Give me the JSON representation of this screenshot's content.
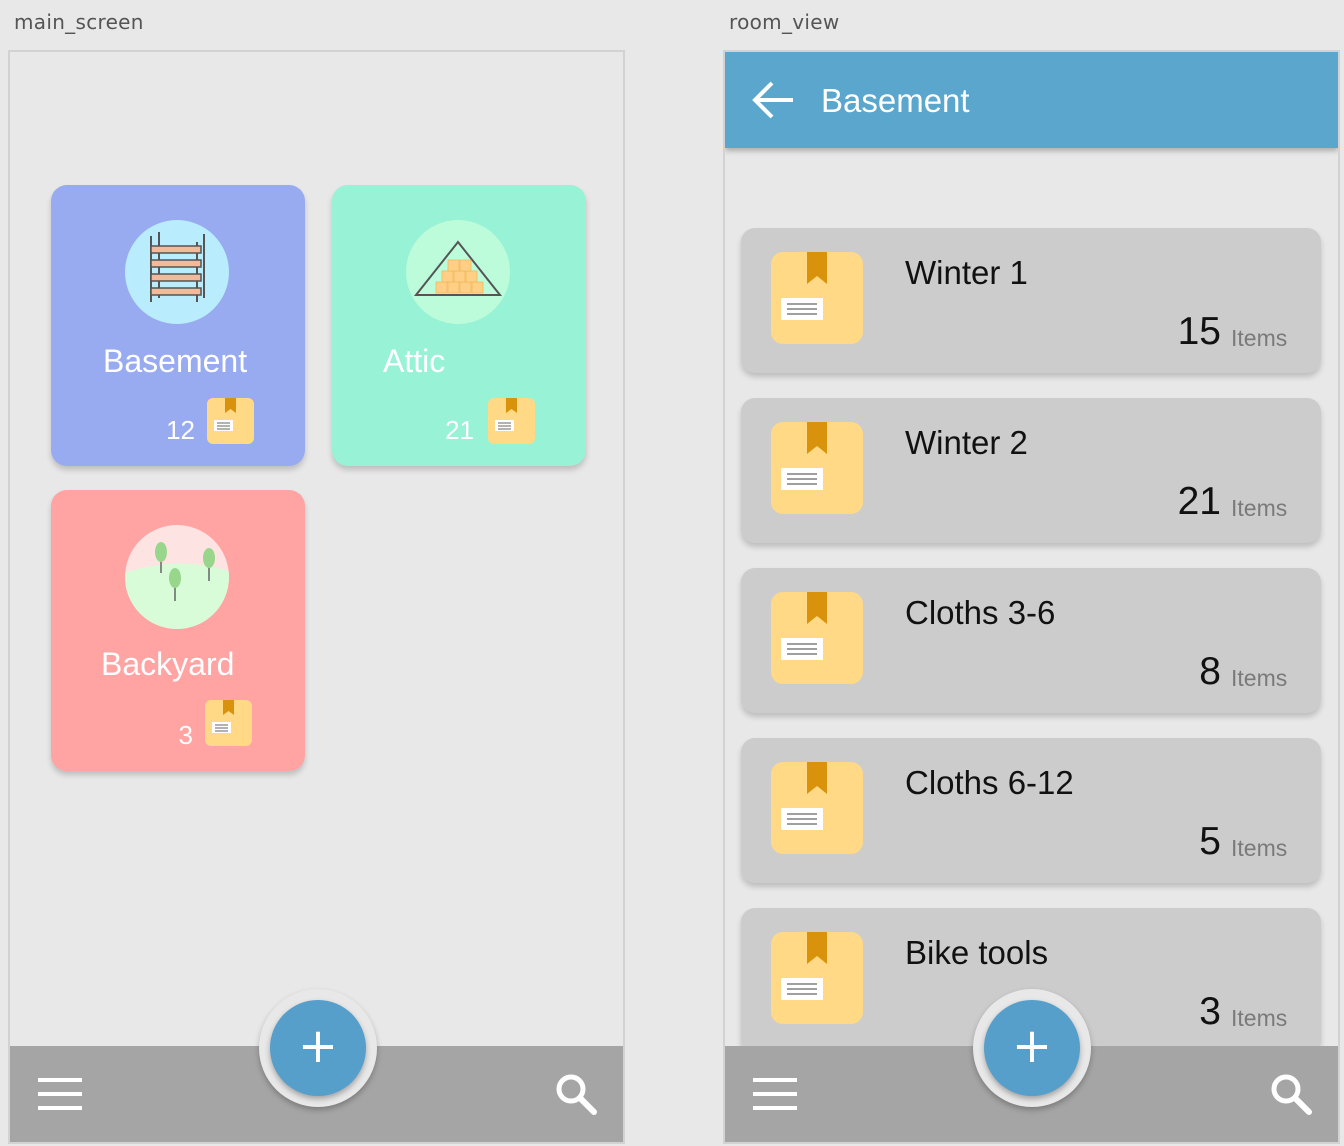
{
  "artboards": {
    "main_label": "main_screen",
    "room_label": "room_view"
  },
  "main_screen": {
    "rooms": [
      {
        "name": "Basement",
        "count": "12",
        "color": "#98abf1",
        "icon": "shelf-icon"
      },
      {
        "name": "Attic",
        "count": "21",
        "color": "#98f2d5",
        "icon": "attic-icon"
      },
      {
        "name": "Backyard",
        "count": "3",
        "color": "#ffa3a3",
        "icon": "trees-icon"
      }
    ],
    "fab_label": "+",
    "bottom_bar_color": "#a5a5a5"
  },
  "room_view": {
    "title": "Basement",
    "app_bar_color": "#5ba6cd",
    "boxes": [
      {
        "name": "Winter 1",
        "count": "15",
        "unit": "Items"
      },
      {
        "name": "Winter 2",
        "count": "21",
        "unit": "Items"
      },
      {
        "name": "Cloths 3-6",
        "count": "8",
        "unit": "Items"
      },
      {
        "name": "Cloths 6-12",
        "count": "5",
        "unit": "Items"
      },
      {
        "name": "Bike tools",
        "count": "3",
        "unit": "Items"
      }
    ],
    "fab_label": "+"
  },
  "colors": {
    "accent": "#579fcb",
    "box_yellow": "#ffd986",
    "ribbon": "#d9920b"
  }
}
